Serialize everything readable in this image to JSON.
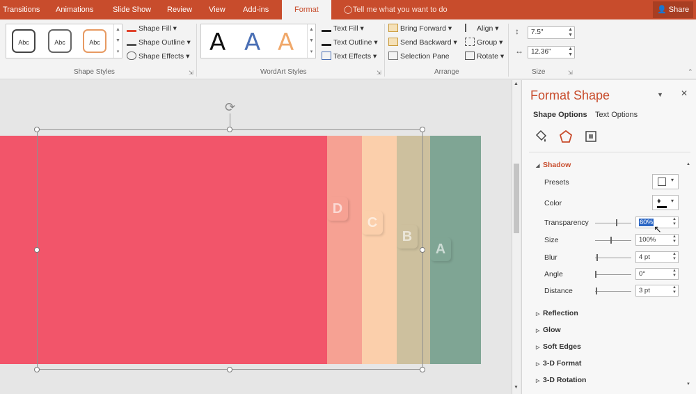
{
  "tabs": {
    "transitions": "Transitions",
    "animations": "Animations",
    "slideshow": "Slide Show",
    "review": "Review",
    "view": "View",
    "addins": "Add-ins",
    "format": "Format"
  },
  "tellme": "Tell me what you want to do",
  "share": "Share",
  "ribbon": {
    "shape_styles": {
      "label": "Shape Styles",
      "thumb_text": "Abc",
      "fill": "Shape Fill",
      "outline": "Shape Outline",
      "effects": "Shape Effects"
    },
    "wordart": {
      "label": "WordArt Styles",
      "letter": "A",
      "text_fill": "Text Fill",
      "text_outline": "Text Outline",
      "text_effects": "Text Effects"
    },
    "arrange": {
      "label": "Arrange",
      "bring_forward": "Bring Forward",
      "send_backward": "Send Backward",
      "selection_pane": "Selection Pane",
      "align": "Align",
      "group": "Group",
      "rotate": "Rotate"
    },
    "size": {
      "label": "Size",
      "height": "7.5\"",
      "width": "12.36\""
    }
  },
  "canvas": {
    "strips": [
      {
        "letter": "",
        "color": "#f2556a"
      },
      {
        "letter": "D",
        "color": "#f6a193"
      },
      {
        "letter": "C",
        "color": "#fbcfab"
      },
      {
        "letter": "B",
        "color": "#cdc09e"
      },
      {
        "letter": "A",
        "color": "#7fa594"
      }
    ]
  },
  "pane": {
    "title": "Format Shape",
    "tab_shape": "Shape Options",
    "tab_text": "Text Options",
    "shadow": "Shadow",
    "presets": "Presets",
    "color": "Color",
    "transparency": "Transparency",
    "transparency_value": "60%",
    "size": "Size",
    "size_value": "100%",
    "blur": "Blur",
    "blur_value": "4 pt",
    "angle": "Angle",
    "angle_value": "0°",
    "distance": "Distance",
    "distance_value": "3 pt",
    "reflection": "Reflection",
    "glow": "Glow",
    "soft_edges": "Soft Edges",
    "format_3d": "3-D Format",
    "rotation_3d": "3-D Rotation"
  },
  "colors": {
    "accent": "#c84c2c",
    "selection_highlight": "#2b66c4"
  }
}
